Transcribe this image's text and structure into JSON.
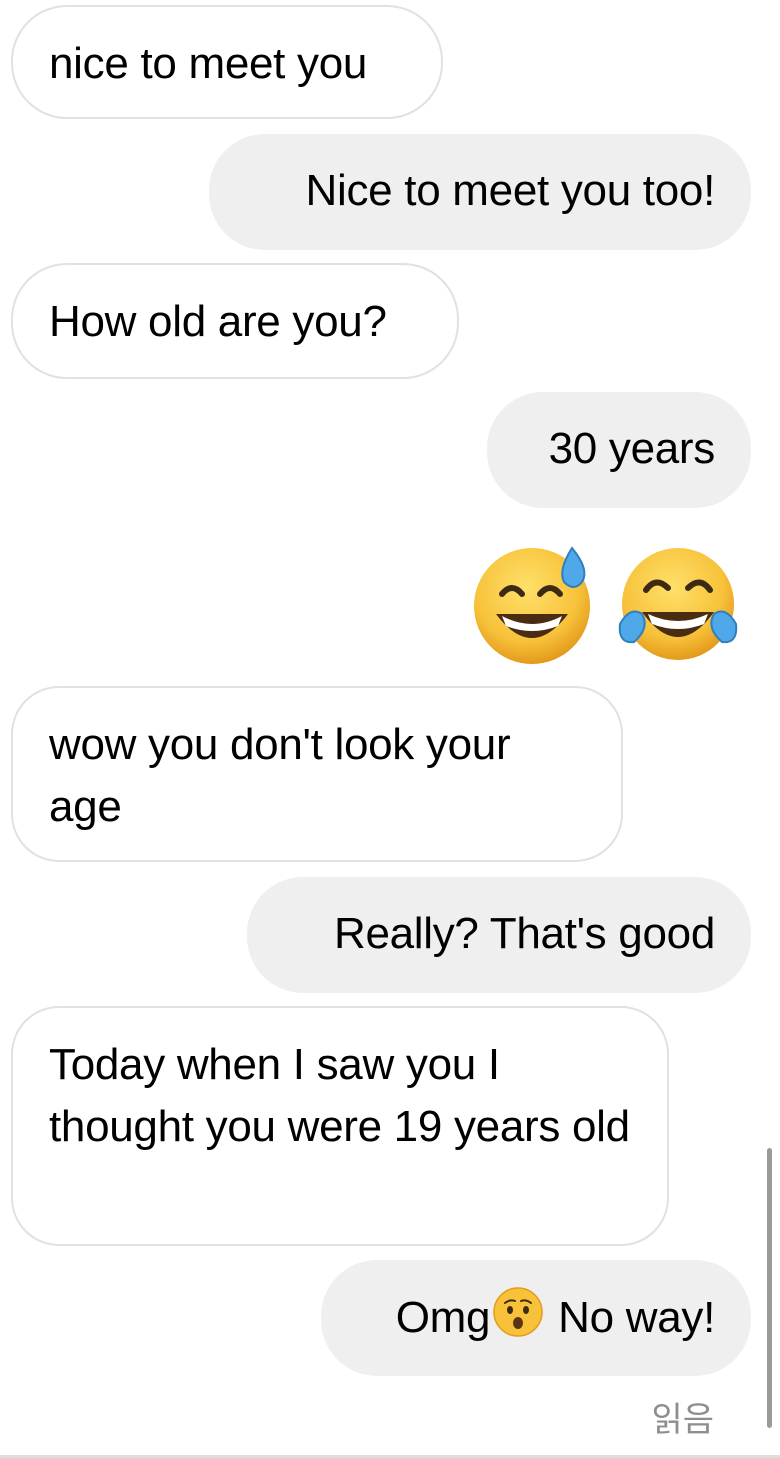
{
  "messages": [
    {
      "sender": "other",
      "text": "nice to meet you"
    },
    {
      "sender": "me",
      "text": "Nice to meet you too!"
    },
    {
      "sender": "other",
      "text": "How old are you?"
    },
    {
      "sender": "me",
      "text": "30 years"
    },
    {
      "sender": "me",
      "emojis": [
        "grinning-face-with-sweat",
        "face-with-tears-of-joy"
      ]
    },
    {
      "sender": "other",
      "text": "wow you don't look your age"
    },
    {
      "sender": "me",
      "text": "Really? That's good"
    },
    {
      "sender": "other",
      "text": "Today when I saw you I thought you were 19 years old"
    },
    {
      "sender": "me",
      "text_before_emoji": "Omg",
      "inline_emoji": "hushed-face",
      "text_after_emoji": "No way!"
    }
  ],
  "read_status": "읽음",
  "colors": {
    "incoming_bubble_bg": "#ffffff",
    "incoming_bubble_border": "#e1e1e1",
    "outgoing_bubble_bg": "#efefef",
    "emoji_yellow": "#f7c23a",
    "read_status_text": "#8e8e8e"
  }
}
